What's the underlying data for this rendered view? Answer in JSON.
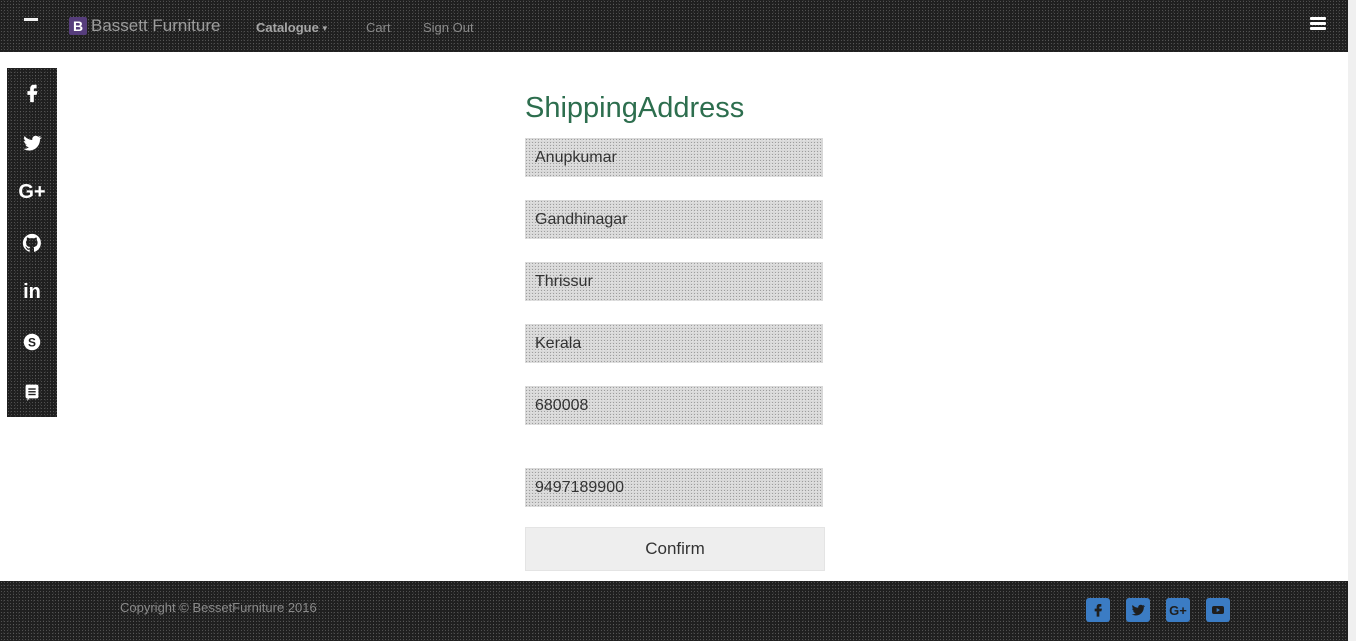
{
  "nav": {
    "brand_logo": "B",
    "brand_name": "Bassett Furniture",
    "catalogue": "Catalogue",
    "cart": "Cart",
    "sign_out": "Sign Out"
  },
  "sidebar": {
    "items": [
      {
        "icon": "facebook-icon",
        "glyph": "f"
      },
      {
        "icon": "twitter-icon",
        "glyph": ""
      },
      {
        "icon": "google-plus-icon",
        "glyph": "G+"
      },
      {
        "icon": "github-icon",
        "glyph": ""
      },
      {
        "icon": "linkedin-icon",
        "glyph": "in"
      },
      {
        "icon": "skype-icon",
        "glyph": "S"
      },
      {
        "icon": "note-icon",
        "glyph": ""
      }
    ]
  },
  "form": {
    "title": "ShippingAddress",
    "fields": [
      {
        "name": "name-field",
        "value": "Anupkumar"
      },
      {
        "name": "address-field",
        "value": "Gandhinagar"
      },
      {
        "name": "city-field",
        "value": "Thrissur"
      },
      {
        "name": "state-field",
        "value": "Kerala"
      },
      {
        "name": "pincode-field",
        "value": "680008"
      },
      {
        "name": "phone-field",
        "value": "9497189900"
      }
    ],
    "confirm_label": "Confirm"
  },
  "footer": {
    "copyright": "Copyright © BessetFurniture 2016",
    "icons": [
      "facebook-icon",
      "twitter-icon",
      "google-plus-icon",
      "youtube-icon"
    ],
    "icon_color": "#3b7cc4"
  },
  "colors": {
    "bar_background": "#1f1f1f",
    "title_green": "#2d6e4e",
    "brand_purple": "#563d7c"
  }
}
